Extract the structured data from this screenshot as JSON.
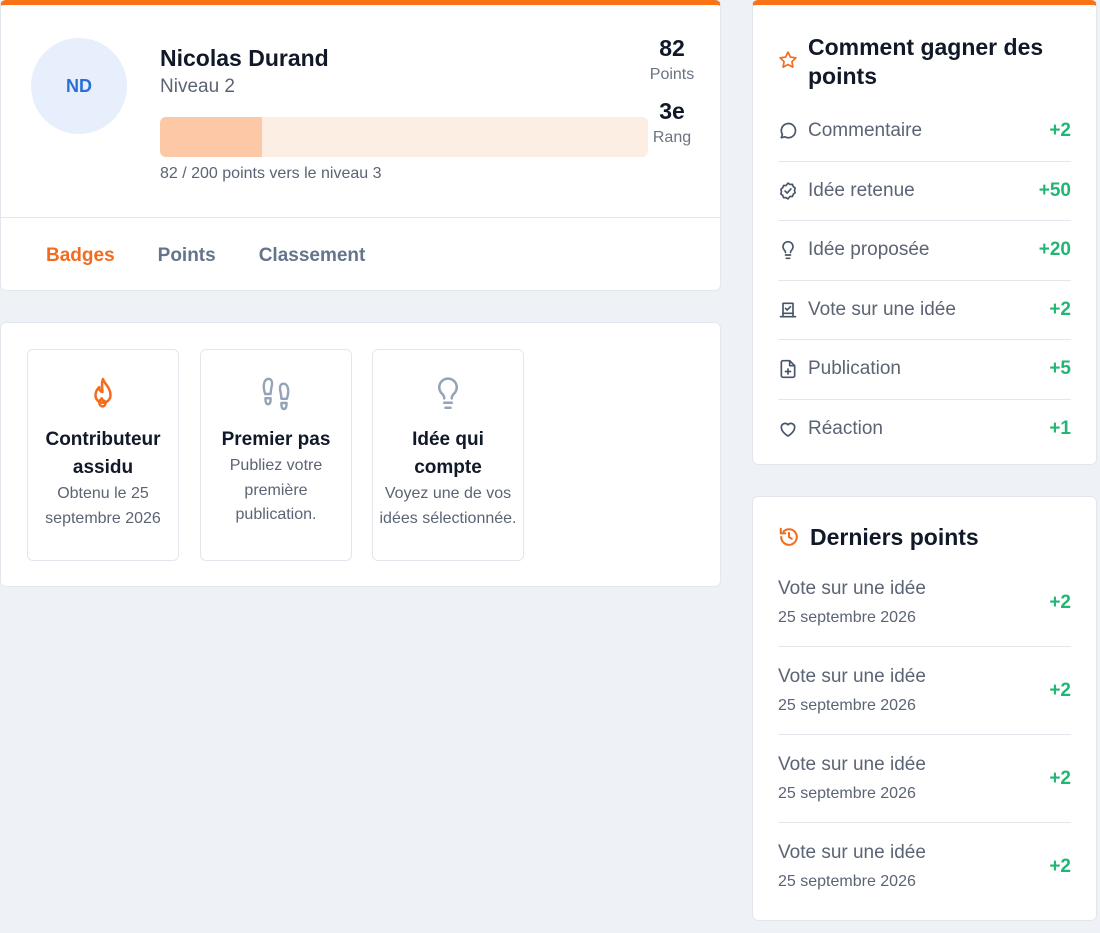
{
  "profile": {
    "initials": "ND",
    "name": "Nicolas Durand",
    "level": "Niveau 2",
    "progress_text": "82 / 200 points vers le niveau 3",
    "progress_fraction": 0.21,
    "points_value": "82",
    "points_label": "Points",
    "rank_value": "3e",
    "rank_label": "Rang"
  },
  "tabs": [
    {
      "label": "Badges",
      "active": true
    },
    {
      "label": "Points",
      "active": false
    },
    {
      "label": "Classement",
      "active": false
    }
  ],
  "badges": [
    {
      "title": "Contributeur assidu",
      "desc": "Obtenu le 25 septembre 2026",
      "icon": "flame-icon",
      "color": "#f36b1c"
    },
    {
      "title": "Premier pas",
      "desc": "Publiez votre première publication.",
      "icon": "footprints-icon",
      "color": "#94a3b8"
    },
    {
      "title": "Idée qui compte",
      "desc": "Voyez une de vos idées sélectionnée.",
      "icon": "lightbulb-icon",
      "color": "#94a3b8"
    }
  ],
  "earn": {
    "title": "Comment gagner des points",
    "icon": "star-icon",
    "rows": [
      {
        "label": "Commentaire",
        "value": "+2",
        "icon": "comment-icon"
      },
      {
        "label": "Idée retenue",
        "value": "+50",
        "icon": "badge-check-icon"
      },
      {
        "label": "Idée proposée",
        "value": "+20",
        "icon": "lightbulb-icon"
      },
      {
        "label": "Vote sur une idée",
        "value": "+2",
        "icon": "vote-icon"
      },
      {
        "label": "Publication",
        "value": "+5",
        "icon": "file-plus-icon"
      },
      {
        "label": "Réaction",
        "value": "+1",
        "icon": "heart-icon"
      }
    ]
  },
  "recent": {
    "title": "Derniers points",
    "icon": "history-icon",
    "rows": [
      {
        "label": "Vote sur une idée",
        "date": "25 septembre 2026",
        "value": "+2"
      },
      {
        "label": "Vote sur une idée",
        "date": "25 septembre 2026",
        "value": "+2"
      },
      {
        "label": "Vote sur une idée",
        "date": "25 septembre 2026",
        "value": "+2"
      },
      {
        "label": "Vote sur une idée",
        "date": "25 septembre 2026",
        "value": "+2"
      }
    ]
  },
  "colors": {
    "accent": "#f97316",
    "positive": "#22b573",
    "progress_fill": "#fdc8a5",
    "progress_track": "#fdeee3"
  }
}
